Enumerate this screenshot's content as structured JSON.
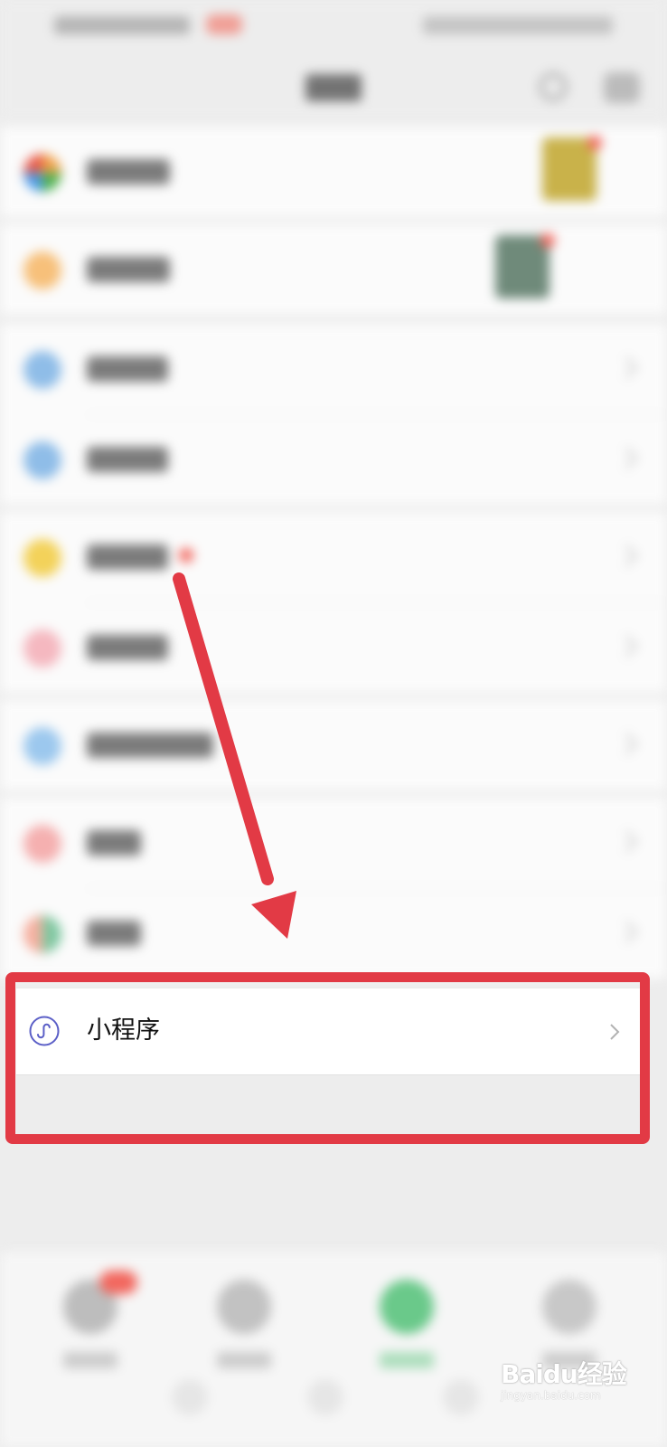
{
  "highlighted_item": {
    "label": "小程序",
    "icon": "mini-program-icon",
    "accent": "#5b5fc7"
  },
  "annotation": {
    "color": "#e23a45",
    "arrow": "pointing-down-to-highlight"
  },
  "watermark": {
    "text": "Baidu经验",
    "sub": "jingyan.baidu.com"
  },
  "colors": {
    "background": "#ededed",
    "row": "#ffffff",
    "highlight": "#e23a45"
  }
}
